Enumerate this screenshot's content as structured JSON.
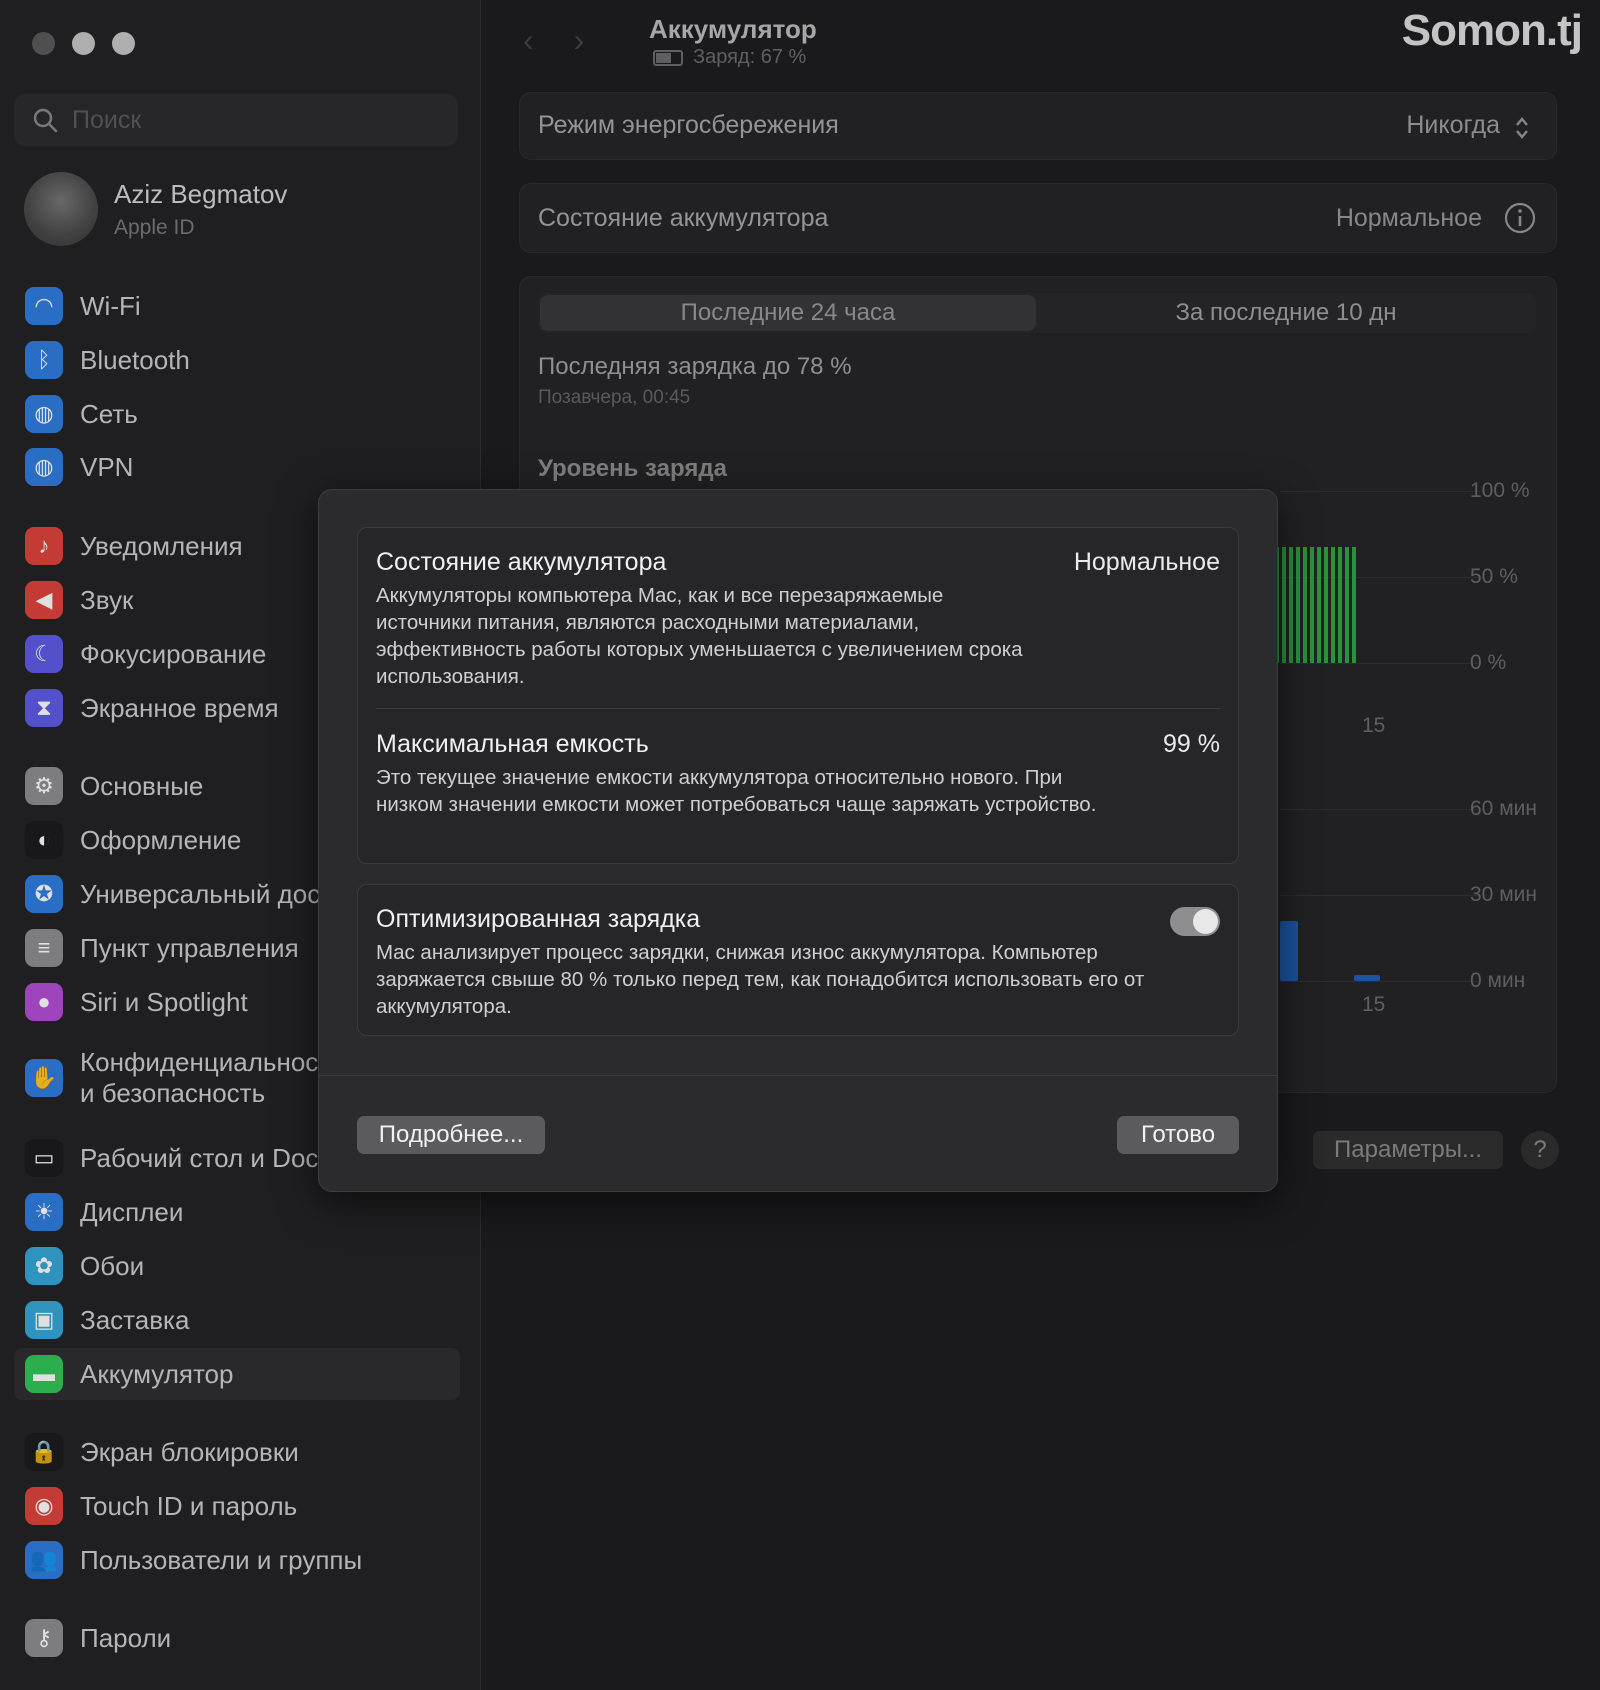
{
  "watermark": "Somon.tj",
  "window": {
    "title": "Аккумулятор",
    "subtitle": "Заряд: 67 %"
  },
  "sidebar": {
    "search_placeholder": "Поиск",
    "user": {
      "name": "Aziz Begmatov",
      "sub": "Apple ID"
    },
    "items": [
      {
        "label": "Wi‑Fi",
        "icon": "wifi-icon",
        "color": "#2f7de1"
      },
      {
        "label": "Bluetooth",
        "icon": "bluetooth-icon",
        "color": "#2f7de1"
      },
      {
        "label": "Сеть",
        "icon": "globe-icon",
        "color": "#2f7de1"
      },
      {
        "label": "VPN",
        "icon": "vpn-globe-icon",
        "color": "#2f7de1"
      },
      {
        "label": "Уведомления",
        "icon": "bell-icon",
        "color": "#e0443e"
      },
      {
        "label": "Звук",
        "icon": "speaker-icon",
        "color": "#e0443e"
      },
      {
        "label": "Фокусирование",
        "icon": "moon-icon",
        "color": "#5e5ce6"
      },
      {
        "label": "Экранное время",
        "icon": "hourglass-icon",
        "color": "#5e5ce6"
      },
      {
        "label": "Основные",
        "icon": "gear-icon",
        "color": "#8e8e93"
      },
      {
        "label": "Оформление",
        "icon": "appearance-icon",
        "color": "#1c1c1e"
      },
      {
        "label": "Универсальный дост",
        "icon": "accessibility-icon",
        "color": "#2f7de1"
      },
      {
        "label": "Пункт управления",
        "icon": "control-center-icon",
        "color": "#8e8e93"
      },
      {
        "label": "Siri и Spotlight",
        "icon": "siri-icon",
        "color": "#b44ed6"
      },
      {
        "label": "Конфиденциальност\nи безопасность",
        "icon": "hand-icon",
        "color": "#2f7de1"
      },
      {
        "label": "Рабочий стол и Dock",
        "icon": "dock-icon",
        "color": "#1c1c1e"
      },
      {
        "label": "Дисплеи",
        "icon": "sun-icon",
        "color": "#2f7de1"
      },
      {
        "label": "Обои",
        "icon": "flower-icon",
        "color": "#36a8d8"
      },
      {
        "label": "Заставка",
        "icon": "screensaver-icon",
        "color": "#36a8d8"
      },
      {
        "label": "Аккумулятор",
        "icon": "battery-icon",
        "color": "#34c759"
      },
      {
        "label": "Экран блокировки",
        "icon": "lock-icon",
        "color": "#1c1c1e"
      },
      {
        "label": "Touch ID и пароль",
        "icon": "fingerprint-icon",
        "color": "#e0443e"
      },
      {
        "label": "Пользователи и группы",
        "icon": "users-icon",
        "color": "#2f7de1"
      },
      {
        "label": "Пароли",
        "icon": "key-icon",
        "color": "#8e8e93"
      }
    ]
  },
  "main": {
    "energy_mode": {
      "label": "Режим энергосбережения",
      "value": "Никогда"
    },
    "battery_state": {
      "label": "Состояние аккумулятора",
      "value": "Нормальное"
    },
    "tabs": [
      "Последние 24 часа",
      "За последние 10 дн"
    ],
    "last_charge": {
      "title": "Последняя зарядка до 78 %",
      "sub": "Позавчера, 00:45"
    },
    "level_title": "Уровень заряда",
    "y1_ticks": [
      "100 %",
      "50 %",
      "0 %"
    ],
    "y2_ticks": [
      "60 мин",
      "30 мин",
      "0 мин"
    ],
    "x_tick": "15",
    "params_button": "Параметры...",
    "help": "?"
  },
  "modal": {
    "state": {
      "title": "Состояние аккумулятора",
      "value": "Нормальное",
      "desc": "Аккумуляторы компьютера Mac, как и все перезаряжаемые источники питания, являются расходными материалами, эффективность работы которых уменьшается с увеличением срока использования."
    },
    "capacity": {
      "title": "Максимальная емкость",
      "value": "99 %",
      "desc": "Это текущее значение емкости аккумулятора относительно нового. При низком значении емкости может потребоваться чаще заряжать устройство."
    },
    "optimized": {
      "title": "Оптимизированная зарядка",
      "enabled": true,
      "desc": "Mac анализирует процесс зарядки, снижая износ аккумулятора. Компьютер заряжается свыше 80 % только перед тем, как понадобится использовать его от аккумулятора."
    },
    "more_button": "Подробнее...",
    "done_button": "Готово"
  }
}
